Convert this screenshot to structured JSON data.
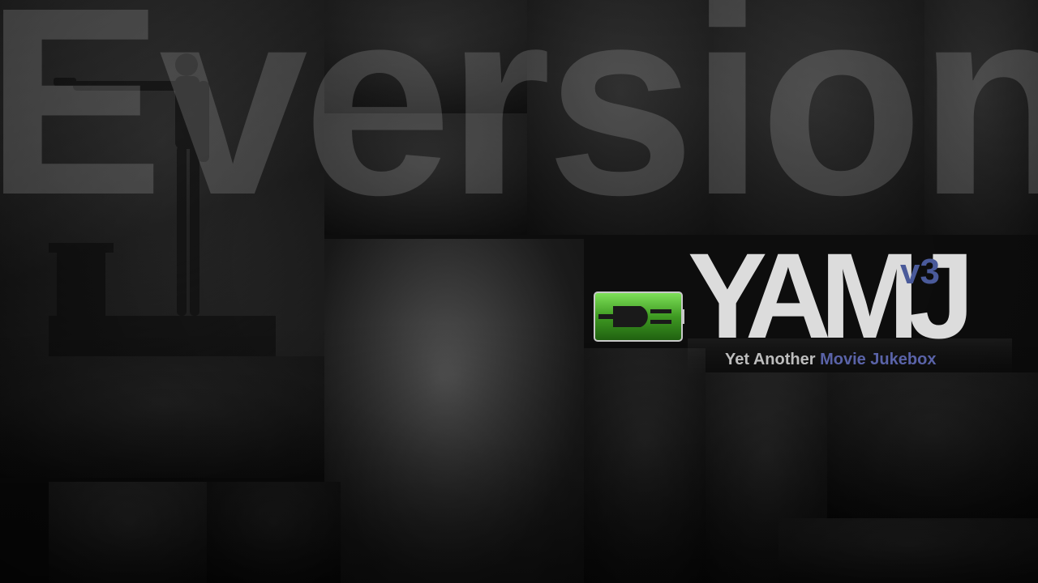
{
  "background": {
    "watermark_text": "Eversion"
  },
  "logo": {
    "main_text": "YAMJ",
    "version": "v3",
    "tagline_part1": "Yet Another ",
    "tagline_part2": "Movie Jukebox"
  },
  "status": {
    "power_icon": "plug-battery-icon",
    "power_color": "#3f9a22"
  },
  "colors": {
    "background": "#0d0d0d",
    "logo_text": "#dcdcdc",
    "accent": "#4a5a9a"
  }
}
